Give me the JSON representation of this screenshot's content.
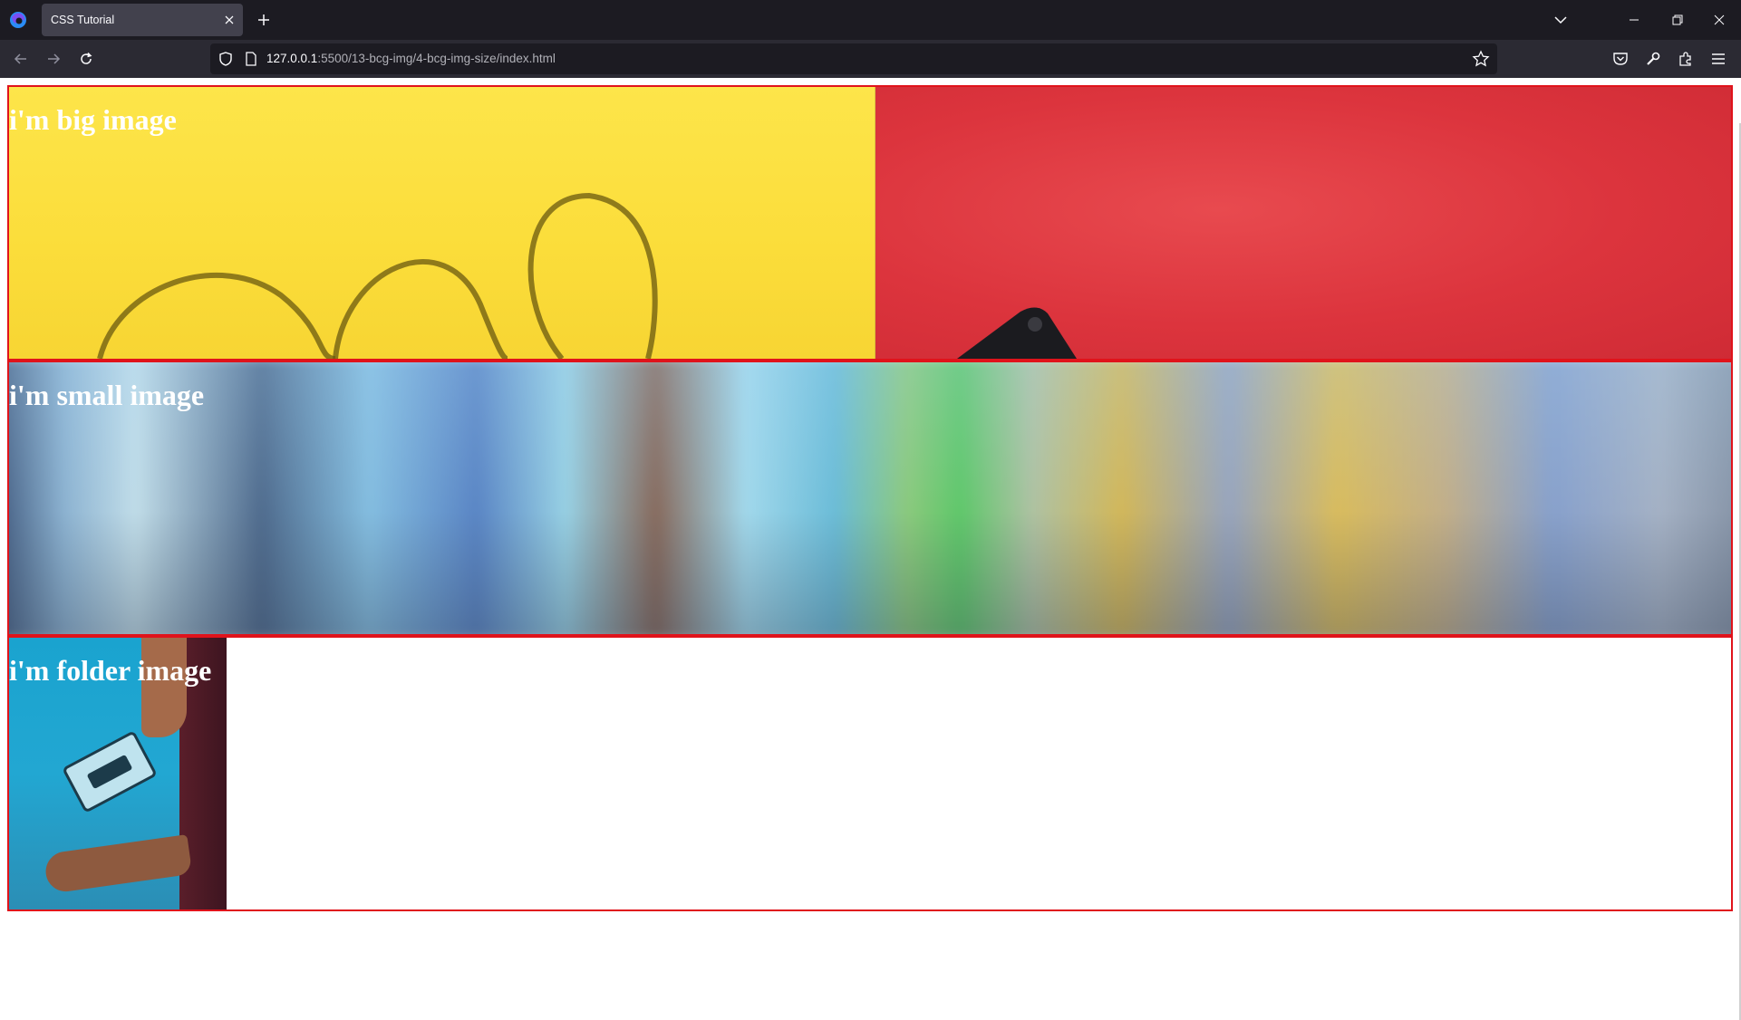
{
  "browser": {
    "tab_title": "CSS Tutorial",
    "url_host": "127.0.0.1",
    "url_path": ":5500/13-bcg-img/4-bcg-img-size/index.html"
  },
  "page": {
    "sections": [
      {
        "heading": "i'm big image"
      },
      {
        "heading": "i'm small image"
      },
      {
        "heading": "i'm folder image"
      }
    ],
    "border_color": "#e0131b"
  }
}
